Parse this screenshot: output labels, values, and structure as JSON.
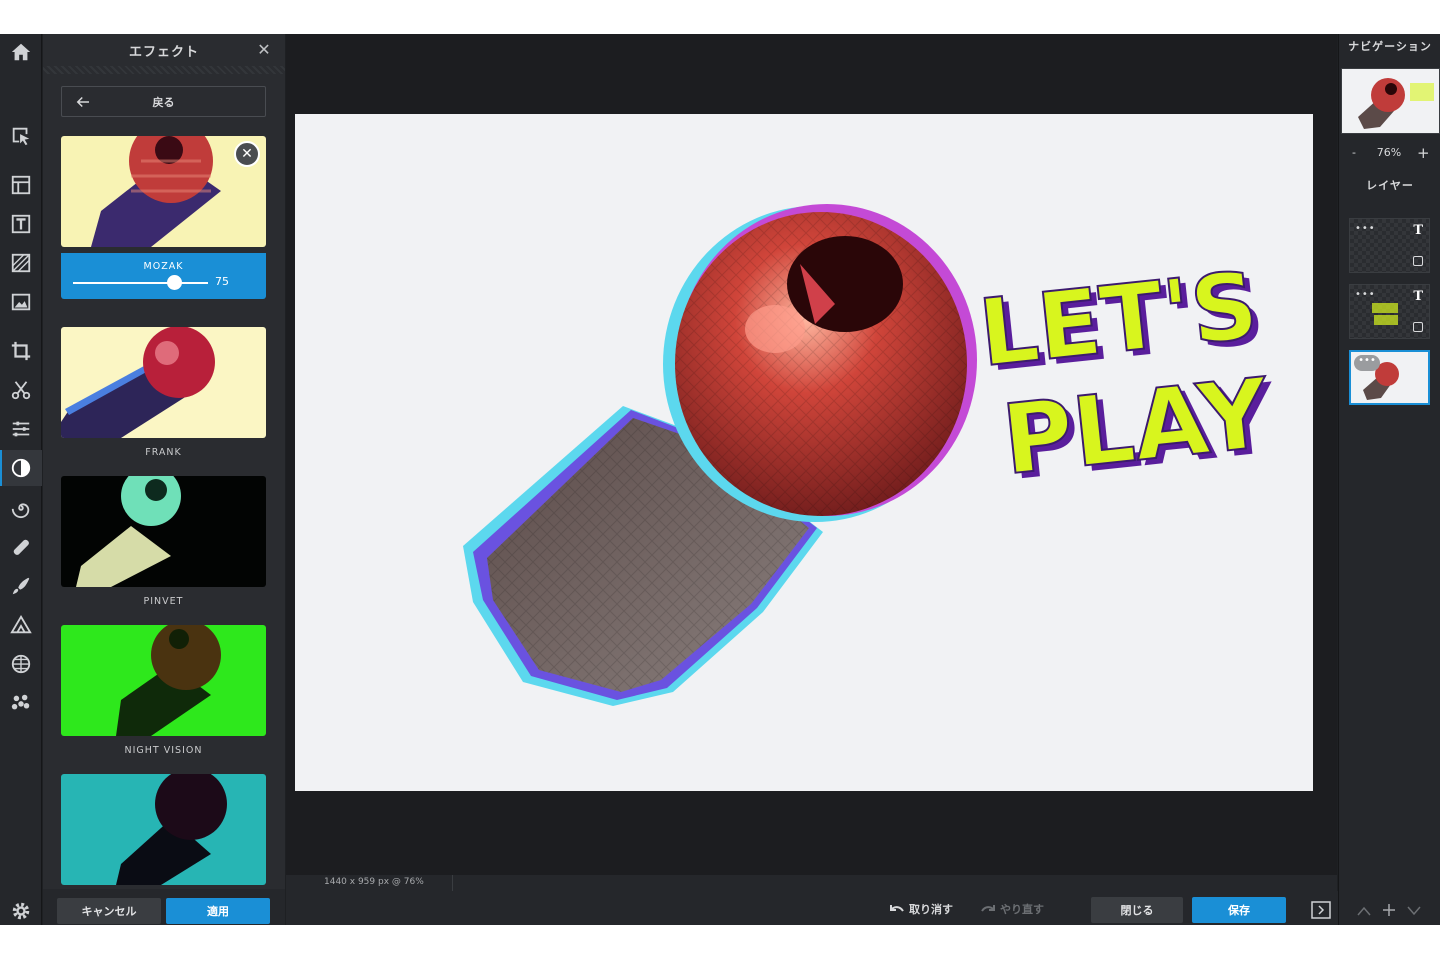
{
  "effects_panel": {
    "title": "エフェクト",
    "back_label": "戻る",
    "active_effect": {
      "name": "MOZAK",
      "value": "75",
      "slider_fraction": 0.75
    },
    "effects": [
      {
        "label": "FRANK"
      },
      {
        "label": "PINVET"
      },
      {
        "label": "NIGHT VISION"
      }
    ],
    "cancel_label": "キャンセル",
    "apply_label": "適用"
  },
  "canvas": {
    "status": "1440 x 959 px @ 76%",
    "text_overlay_line1": "LET'S",
    "text_overlay_line2": "PLAY"
  },
  "bottom_bar": {
    "undo_label": "取り消す",
    "redo_label": "やり直す",
    "close_label": "閉じる",
    "save_label": "保存"
  },
  "right_panel": {
    "navigation_title": "ナビゲーション",
    "zoom_minus": "-",
    "zoom_value": "76%",
    "zoom_plus": "+",
    "layers_title": "レイヤー"
  },
  "colors": {
    "accent": "#1a8fd6",
    "background": "#1e2023",
    "text_lime": "#d8f51e",
    "text_shadow": "#5a1e9c"
  },
  "tools": [
    "home-icon",
    "select-icon",
    "layout-icon",
    "text-icon",
    "pattern-icon",
    "image-icon",
    "crop-icon",
    "cut-icon",
    "adjust-icon",
    "effect-icon",
    "liquify-icon",
    "heal-icon",
    "brush-icon",
    "shape-icon",
    "texture-icon",
    "sticker-icon",
    "settings-icon"
  ]
}
